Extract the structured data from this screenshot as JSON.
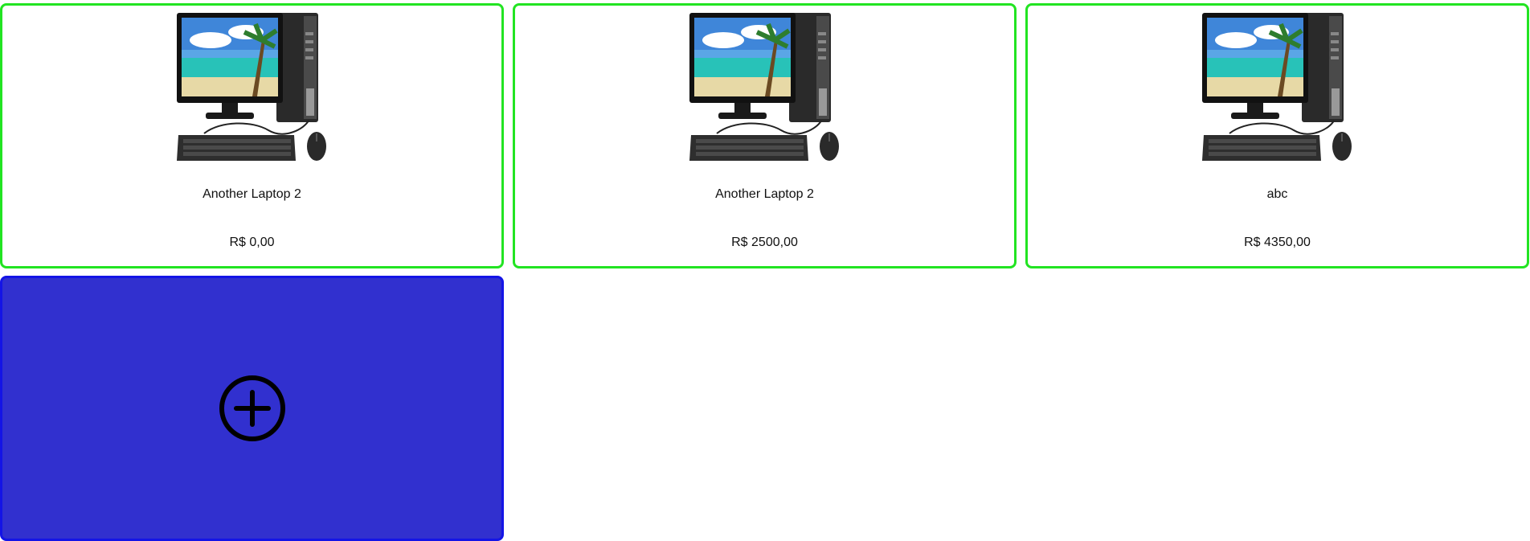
{
  "products": [
    {
      "name": "Another Laptop 2",
      "price": "R$ 0,00",
      "image_icon": "desktop-computer-icon"
    },
    {
      "name": "Another Laptop 2",
      "price": "R$ 2500,00",
      "image_icon": "desktop-computer-icon"
    },
    {
      "name": "abc",
      "price": "R$ 4350,00",
      "image_icon": "desktop-computer-icon"
    }
  ],
  "add_card": {
    "icon": "plus-circle-icon"
  },
  "colors": {
    "card_border": "#22e422",
    "add_card_background": "#3130cf",
    "add_card_border": "#1414e6",
    "icon_stroke": "#000000"
  }
}
